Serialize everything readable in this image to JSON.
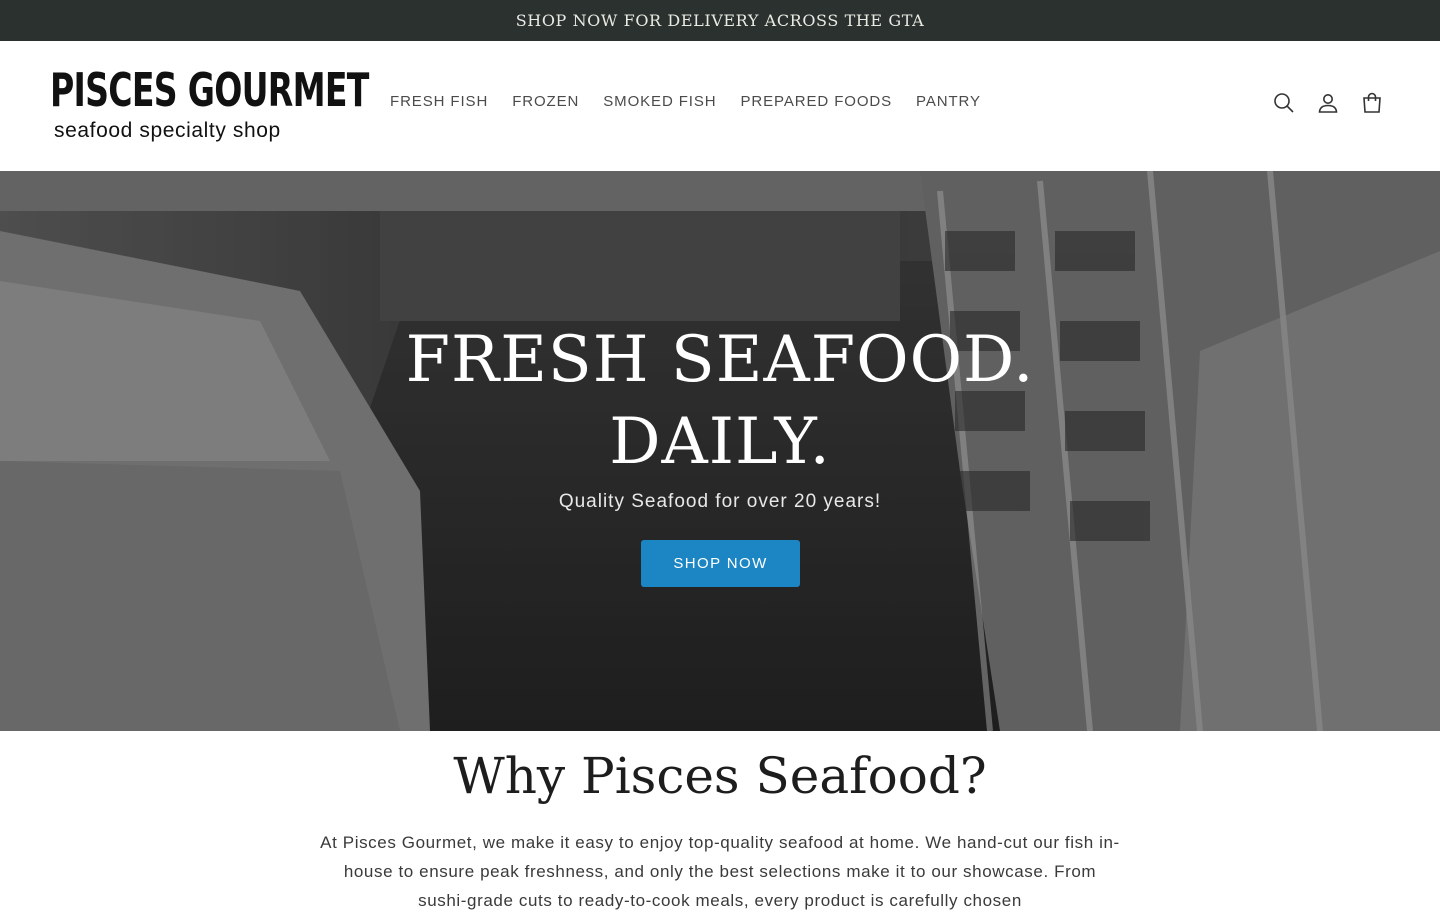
{
  "announcement": {
    "text": "SHOP NOW FOR DELIVERY ACROSS THE GTA"
  },
  "logo": {
    "top": "PISCES GOURMET",
    "bottom": "seafood specialty shop"
  },
  "nav": {
    "items": [
      {
        "label": "FRESH FISH"
      },
      {
        "label": "FROZEN"
      },
      {
        "label": "SMOKED FISH"
      },
      {
        "label": "PREPARED FOODS"
      },
      {
        "label": "PANTRY"
      }
    ]
  },
  "header_icons": [
    "search-icon",
    "account-icon",
    "cart-icon"
  ],
  "hero": {
    "title_line1": "FRESH SEAFOOD.",
    "title_line2": "DAILY.",
    "subtitle": "Quality Seafood for over 20 years!",
    "button_label": "SHOP NOW"
  },
  "why": {
    "title": "Why Pisces Seafood?",
    "body": "At Pisces Gourmet, we make it easy to enjoy top-quality seafood at home. We hand-cut our fish in-house to ensure peak freshness, and only the best selections make it to our showcase. From sushi-grade cuts to ready-to-cook meals, every product is carefully chosen"
  },
  "colors": {
    "announcement_bg": "#2a312e",
    "accent_button": "#1c86c4",
    "nav_text": "#4b4b4b"
  }
}
